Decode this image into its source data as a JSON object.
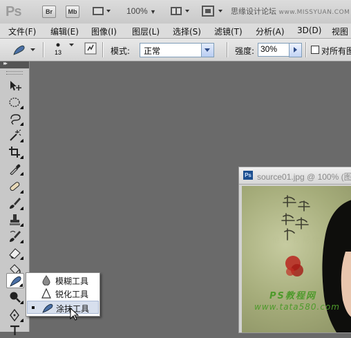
{
  "app": {
    "logo": "Ps",
    "bridge_btn": "Br",
    "minibridge_btn": "Mb",
    "zoom": "100%",
    "site_text": "思缘设计论坛",
    "site_url": "www.MISSYUAN.COM"
  },
  "menu": {
    "items": [
      "文件(F)",
      "编辑(E)",
      "图像(I)",
      "图层(L)",
      "选择(S)",
      "滤镜(T)",
      "分析(A)",
      "3D(D)",
      "视图"
    ]
  },
  "options": {
    "brush_size": "13",
    "mode_label": "模式:",
    "mode_value": "正常",
    "strength_label": "强度:",
    "strength_value": "30%",
    "sample_all_label": "对所有图"
  },
  "document": {
    "icon": "Ps",
    "title": "source01.jpg @ 100% (图",
    "calligraphy": "他 她 我 帮 你",
    "watermark_1": "PS教程网",
    "watermark_2": "www.tata580.com"
  },
  "flyout": {
    "items": [
      {
        "label": "模糊工具",
        "icon": "blur-icon"
      },
      {
        "label": "锐化工具",
        "icon": "sharpen-icon"
      },
      {
        "label": "涂抹工具",
        "icon": "smudge-icon",
        "selected": true
      }
    ]
  },
  "tools": [
    "move-icon",
    "marquee-icon",
    "lasso-icon",
    "magic-wand-icon",
    "crop-icon",
    "eyedropper-icon",
    "healing-brush-icon",
    "brush-icon",
    "clone-stamp-icon",
    "history-brush-icon",
    "eraser-icon",
    "paint-bucket-icon",
    "smudge-icon",
    "dodge-icon",
    "pen-icon",
    "type-icon"
  ],
  "colors": {
    "workspace": "#6a6a6a",
    "selection": "#d7dfed",
    "doc_blue": "#1d4f8f"
  }
}
